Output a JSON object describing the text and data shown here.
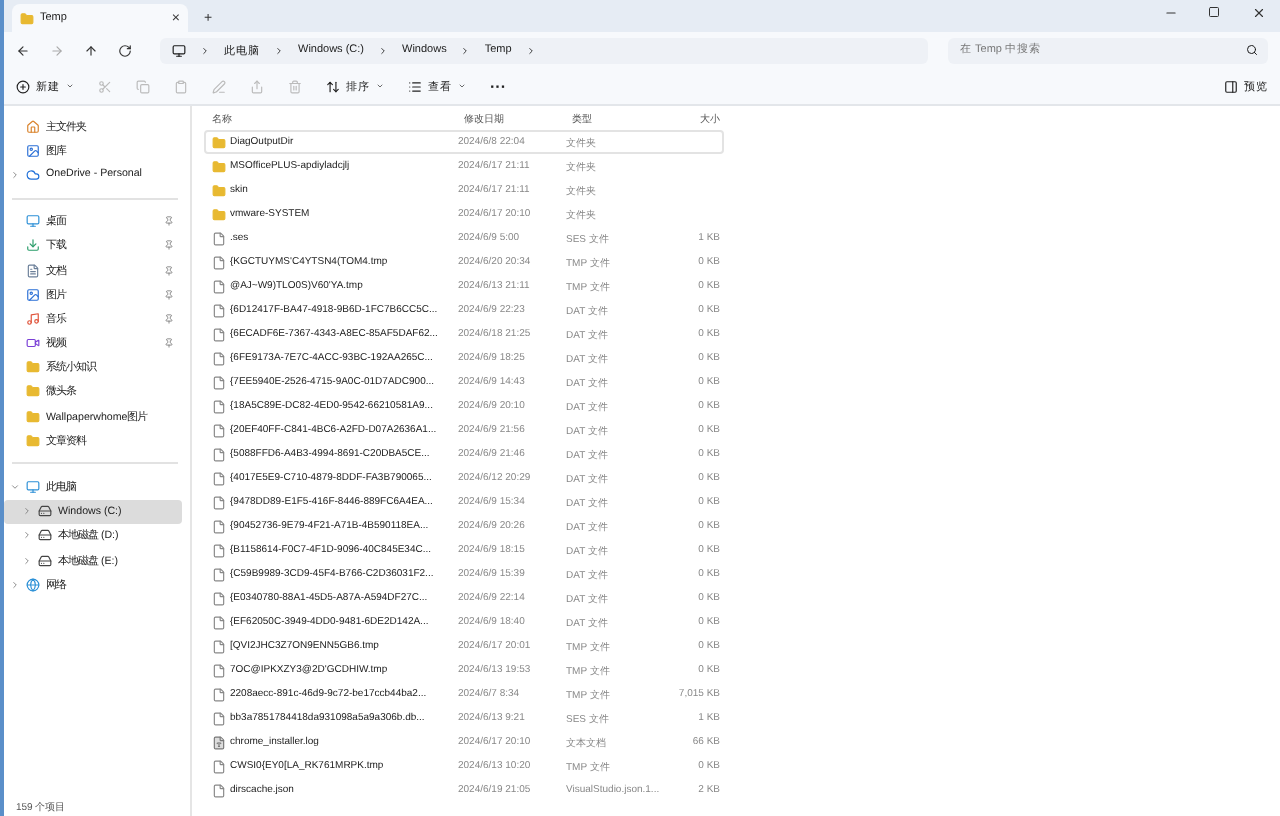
{
  "tab": {
    "title": "Temp",
    "close": "×",
    "new_tab": "+"
  },
  "breadcrumb": [
    "此电脑",
    "Windows (C:)",
    "Windows",
    "Temp"
  ],
  "search": {
    "placeholder": "在 Temp 中搜索"
  },
  "command_bar": {
    "new": "新建",
    "sort": "排序",
    "view": "查看",
    "more": "···",
    "preview": "预览"
  },
  "sidebar": {
    "groups": [
      [
        {
          "label": "主文件夹",
          "kind": "home",
          "pinned": false,
          "selected": false
        },
        {
          "label": "图库",
          "kind": "gallery",
          "pinned": false,
          "selected": false
        },
        {
          "label": "OneDrive - Personal",
          "kind": "cloud",
          "pinned": false,
          "selected": false,
          "expanded": false
        }
      ],
      [
        {
          "label": "桌面",
          "kind": "desktop",
          "pinned": true,
          "selected": false
        },
        {
          "label": "下载",
          "kind": "download",
          "pinned": true,
          "selected": false
        },
        {
          "label": "文档",
          "kind": "document",
          "pinned": true,
          "selected": false
        },
        {
          "label": "图片",
          "kind": "picture",
          "pinned": true,
          "selected": false
        },
        {
          "label": "音乐",
          "kind": "music",
          "pinned": true,
          "selected": false
        },
        {
          "label": "视频",
          "kind": "video",
          "pinned": true,
          "selected": false
        },
        {
          "label": "系统小知识",
          "kind": "folder",
          "pinned": false,
          "selected": false
        },
        {
          "label": "微头条",
          "kind": "folder",
          "pinned": false,
          "selected": false
        },
        {
          "label": "Wallpaperwhome图片",
          "kind": "folder",
          "pinned": false,
          "selected": false
        },
        {
          "label": "文章资料",
          "kind": "folder",
          "pinned": false,
          "selected": false
        }
      ],
      [
        {
          "label": "此电脑",
          "kind": "pc",
          "pinned": false,
          "selected": false,
          "expanded": true,
          "children": [
            {
              "label": "Windows (C:)",
              "kind": "drive",
              "pinned": false,
              "selected": true,
              "expanded": false
            },
            {
              "label": "本地磁盘 (D:)",
              "kind": "drive",
              "pinned": false,
              "selected": false,
              "expanded": false
            },
            {
              "label": "本地磁盘 (E:)",
              "kind": "drive",
              "pinned": false,
              "selected": false,
              "expanded": false
            }
          ]
        },
        {
          "label": "网络",
          "kind": "network",
          "pinned": false,
          "selected": false,
          "expanded": false
        }
      ]
    ]
  },
  "table": {
    "columns": [
      "名称",
      "修改日期",
      "类型",
      "大小"
    ],
    "rows": [
      {
        "name": "DiagOutputDir",
        "kind": "folder",
        "date": "2024/6/8 22:04",
        "type": "文件夹",
        "selected": true
      },
      {
        "name": "MSOfficePLUS-apdiyladcjlj",
        "kind": "folder",
        "date": "2024/6/17 21:11",
        "type": "文件夹",
        "selected": false
      },
      {
        "name": "skin",
        "kind": "folder",
        "date": "2024/6/17 21:11",
        "type": "文件夹",
        "selected": false
      },
      {
        "name": "vmware-SYSTEM",
        "kind": "folder",
        "date": "2024/6/17 20:10",
        "type": "文件夹",
        "selected": false
      },
      {
        "name": ".ses",
        "kind": "file",
        "date": "2024/6/9 5:00",
        "type": "SES 文件",
        "size": "1 KB",
        "selected": false
      },
      {
        "name": "{KGCTUYMS'C4YTSN4(TOM4.tmp",
        "kind": "file",
        "date": "2024/6/20 20:34",
        "type": "TMP 文件",
        "size": "0 KB",
        "selected": false
      },
      {
        "name": "@AJ~W9)TLO0S)V60'YA.tmp",
        "kind": "file",
        "date": "2024/6/13 21:11",
        "type": "TMP 文件",
        "size": "0 KB",
        "selected": false
      },
      {
        "name": "{6D12417F-BA47-4918-9B6D-1FC7B6CC5C...",
        "kind": "file",
        "date": "2024/6/9 22:23",
        "type": "DAT 文件",
        "size": "0 KB",
        "selected": false
      },
      {
        "name": "{6ECADF6E-7367-4343-A8EC-85AF5DAF62...",
        "kind": "file",
        "date": "2024/6/18 21:25",
        "type": "DAT 文件",
        "size": "0 KB",
        "selected": false
      },
      {
        "name": "{6FE9173A-7E7C-4ACC-93BC-192AA265C...",
        "kind": "file",
        "date": "2024/6/9 18:25",
        "type": "DAT 文件",
        "size": "0 KB",
        "selected": false
      },
      {
        "name": "{7EE5940E-2526-4715-9A0C-01D7ADC900...",
        "kind": "file",
        "date": "2024/6/9 14:43",
        "type": "DAT 文件",
        "size": "0 KB",
        "selected": false
      },
      {
        "name": "{18A5C89E-DC82-4ED0-9542-66210581A9...",
        "kind": "file",
        "date": "2024/6/9 20:10",
        "type": "DAT 文件",
        "size": "0 KB",
        "selected": false
      },
      {
        "name": "{20EF40FF-C841-4BC6-A2FD-D07A2636A1...",
        "kind": "file",
        "date": "2024/6/9 21:56",
        "type": "DAT 文件",
        "size": "0 KB",
        "selected": false
      },
      {
        "name": "{5088FFD6-A4B3-4994-8691-C20DBA5CE...",
        "kind": "file",
        "date": "2024/6/9 21:46",
        "type": "DAT 文件",
        "size": "0 KB",
        "selected": false
      },
      {
        "name": "{4017E5E9-C710-4879-8DDF-FA3B790065...",
        "kind": "file",
        "date": "2024/6/12 20:29",
        "type": "DAT 文件",
        "size": "0 KB",
        "selected": false
      },
      {
        "name": "{9478DD89-E1F5-416F-8446-889FC6A4EA...",
        "kind": "file",
        "date": "2024/6/9 15:34",
        "type": "DAT 文件",
        "size": "0 KB",
        "selected": false
      },
      {
        "name": "{90452736-9E79-4F21-A71B-4B590118EA...",
        "kind": "file",
        "date": "2024/6/9 20:26",
        "type": "DAT 文件",
        "size": "0 KB",
        "selected": false
      },
      {
        "name": "{B1158614-F0C7-4F1D-9096-40C845E34C...",
        "kind": "file",
        "date": "2024/6/9 18:15",
        "type": "DAT 文件",
        "size": "0 KB",
        "selected": false
      },
      {
        "name": "{C59B9989-3CD9-45F4-B766-C2D36031F2...",
        "kind": "file",
        "date": "2024/6/9 15:39",
        "type": "DAT 文件",
        "size": "0 KB",
        "selected": false
      },
      {
        "name": "{E0340780-88A1-45D5-A87A-A594DF27C...",
        "kind": "file",
        "date": "2024/6/9 22:14",
        "type": "DAT 文件",
        "size": "0 KB",
        "selected": false
      },
      {
        "name": "{EF62050C-3949-4DD0-9481-6DE2D142A...",
        "kind": "file",
        "date": "2024/6/9 18:40",
        "type": "DAT 文件",
        "size": "0 KB",
        "selected": false
      },
      {
        "name": "[QVI2JHC3Z7ON9ENN5GB6.tmp",
        "kind": "file",
        "date": "2024/6/17 20:01",
        "type": "TMP 文件",
        "size": "0 KB",
        "selected": false
      },
      {
        "name": "7OC@IPKXZY3@2D'GCDHIW.tmp",
        "kind": "file",
        "date": "2024/6/13 19:53",
        "type": "TMP 文件",
        "size": "0 KB",
        "selected": false
      },
      {
        "name": "2208aecc-891c-46d9-9c72-be17ccb44ba2...",
        "kind": "file",
        "date": "2024/6/7 8:34",
        "type": "TMP 文件",
        "size": "7,015 KB",
        "selected": false
      },
      {
        "name": "bb3a7851784418da931098a5a9a306b.db...",
        "kind": "file",
        "date": "2024/6/13 9:21",
        "type": "SES 文件",
        "size": "1 KB",
        "selected": false
      },
      {
        "name": "chrome_installer.log",
        "kind": "text",
        "date": "2024/6/17 20:10",
        "type": "文本文档",
        "size": "66 KB",
        "selected": false
      },
      {
        "name": "CWSI0{EY0[LA_RK761MRPK.tmp",
        "kind": "file",
        "date": "2024/6/13 10:20",
        "type": "TMP 文件",
        "size": "0 KB",
        "selected": false
      },
      {
        "name": "dirscache.json",
        "kind": "file",
        "date": "2024/6/19 21:05",
        "type": "VisualStudio.json.1...",
        "size": "2 KB",
        "selected": false
      }
    ]
  },
  "status_bar": "159 个项目"
}
